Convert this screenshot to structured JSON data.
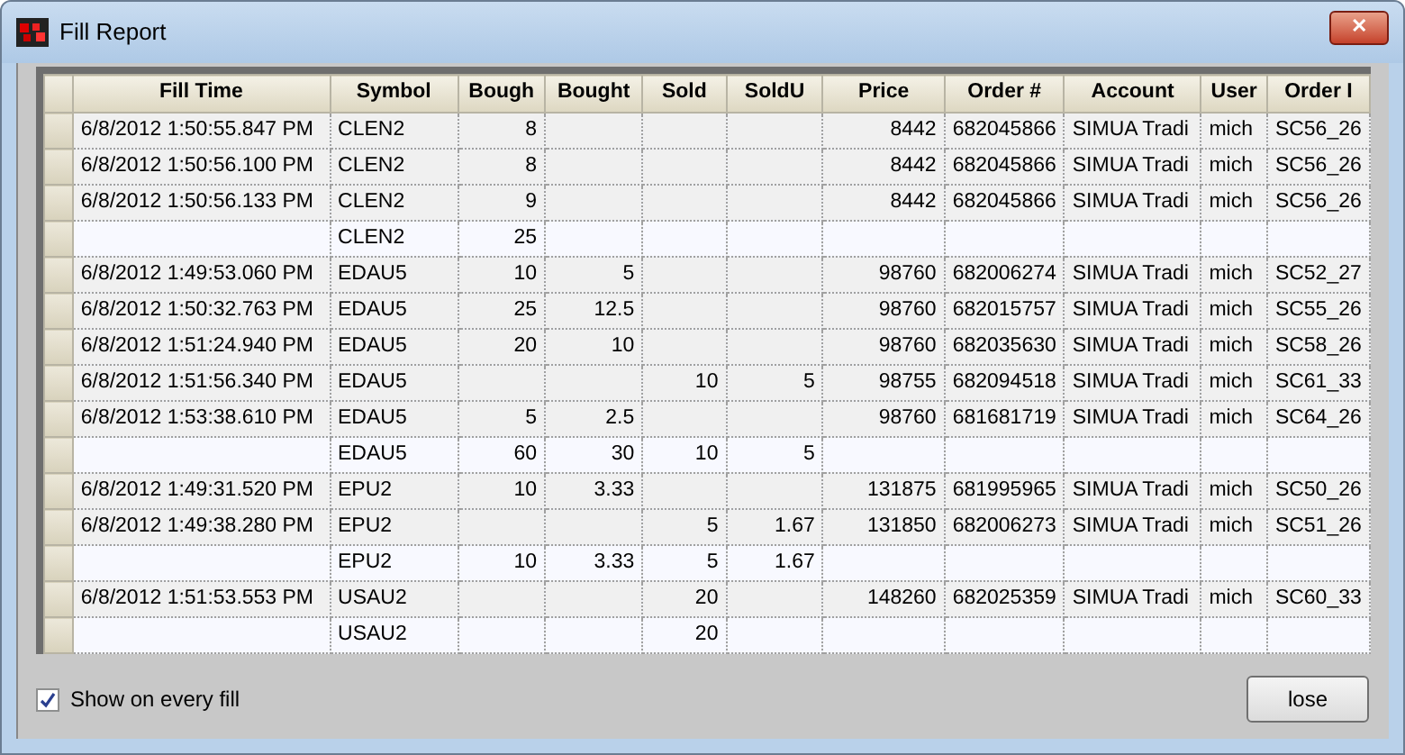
{
  "window": {
    "title": "Fill Report",
    "close_symbol": "✕"
  },
  "table": {
    "columns": [
      "Fill Time",
      "Symbol",
      "Bough",
      "Bought",
      "Sold",
      "SoldU",
      "Price",
      "Order #",
      "Account",
      "User",
      "Order I"
    ],
    "rows": [
      {
        "kind": "fill",
        "cells": [
          "6/8/2012 1:50:55.847 PM",
          "CLEN2",
          "8",
          null,
          null,
          null,
          "8442",
          "682045866",
          "SIMUA Tradi",
          "mich",
          "SC56_26"
        ]
      },
      {
        "kind": "fill",
        "cells": [
          "6/8/2012 1:50:56.100 PM",
          "CLEN2",
          "8",
          null,
          null,
          null,
          "8442",
          "682045866",
          "SIMUA Tradi",
          "mich",
          "SC56_26"
        ]
      },
      {
        "kind": "fill",
        "cells": [
          "6/8/2012 1:50:56.133 PM",
          "CLEN2",
          "9",
          null,
          null,
          null,
          "8442",
          "682045866",
          "SIMUA Tradi",
          "mich",
          "SC56_26"
        ]
      },
      {
        "kind": "total",
        "cells": [
          null,
          "CLEN2",
          "25",
          null,
          null,
          null,
          null,
          null,
          null,
          null,
          null
        ]
      },
      {
        "kind": "fill",
        "cells": [
          "6/8/2012 1:49:53.060 PM",
          "EDAU5",
          "10",
          "5",
          null,
          null,
          "98760",
          "682006274",
          "SIMUA Tradi",
          "mich",
          "SC52_27"
        ]
      },
      {
        "kind": "fill",
        "cells": [
          "6/8/2012 1:50:32.763 PM",
          "EDAU5",
          "25",
          "12.5",
          null,
          null,
          "98760",
          "682015757",
          "SIMUA Tradi",
          "mich",
          "SC55_26"
        ]
      },
      {
        "kind": "fill",
        "cells": [
          "6/8/2012 1:51:24.940 PM",
          "EDAU5",
          "20",
          "10",
          null,
          null,
          "98760",
          "682035630",
          "SIMUA Tradi",
          "mich",
          "SC58_26"
        ]
      },
      {
        "kind": "fill",
        "cells": [
          "6/8/2012 1:51:56.340 PM",
          "EDAU5",
          null,
          null,
          "10",
          "5",
          "98755",
          "682094518",
          "SIMUA Tradi",
          "mich",
          "SC61_33"
        ]
      },
      {
        "kind": "fill",
        "cells": [
          "6/8/2012 1:53:38.610 PM",
          "EDAU5",
          "5",
          "2.5",
          null,
          null,
          "98760",
          "681681719",
          "SIMUA Tradi",
          "mich",
          "SC64_26"
        ]
      },
      {
        "kind": "total",
        "cells": [
          null,
          "EDAU5",
          "60",
          "30",
          "10",
          "5",
          null,
          null,
          null,
          null,
          null
        ]
      },
      {
        "kind": "fill",
        "cells": [
          "6/8/2012 1:49:31.520 PM",
          "EPU2",
          "10",
          "3.33",
          null,
          null,
          "131875",
          "681995965",
          "SIMUA Tradi",
          "mich",
          "SC50_26"
        ]
      },
      {
        "kind": "fill",
        "cells": [
          "6/8/2012 1:49:38.280 PM",
          "EPU2",
          null,
          null,
          "5",
          "1.67",
          "131850",
          "682006273",
          "SIMUA Tradi",
          "mich",
          "SC51_26"
        ]
      },
      {
        "kind": "total",
        "cells": [
          null,
          "EPU2",
          "10",
          "3.33",
          "5",
          "1.67",
          null,
          null,
          null,
          null,
          null
        ]
      },
      {
        "kind": "fill",
        "cells": [
          "6/8/2012 1:51:53.553 PM",
          "USAU2",
          null,
          null,
          "20",
          null,
          "148260",
          "682025359",
          "SIMUA Tradi",
          "mich",
          "SC60_33"
        ]
      },
      {
        "kind": "total",
        "cells": [
          null,
          "USAU2",
          null,
          null,
          "20",
          null,
          null,
          null,
          null,
          null,
          null
        ]
      }
    ]
  },
  "show_on_every_fill": {
    "label": "Show on every fill",
    "checked": true
  },
  "buttons": [
    "lose"
  ]
}
